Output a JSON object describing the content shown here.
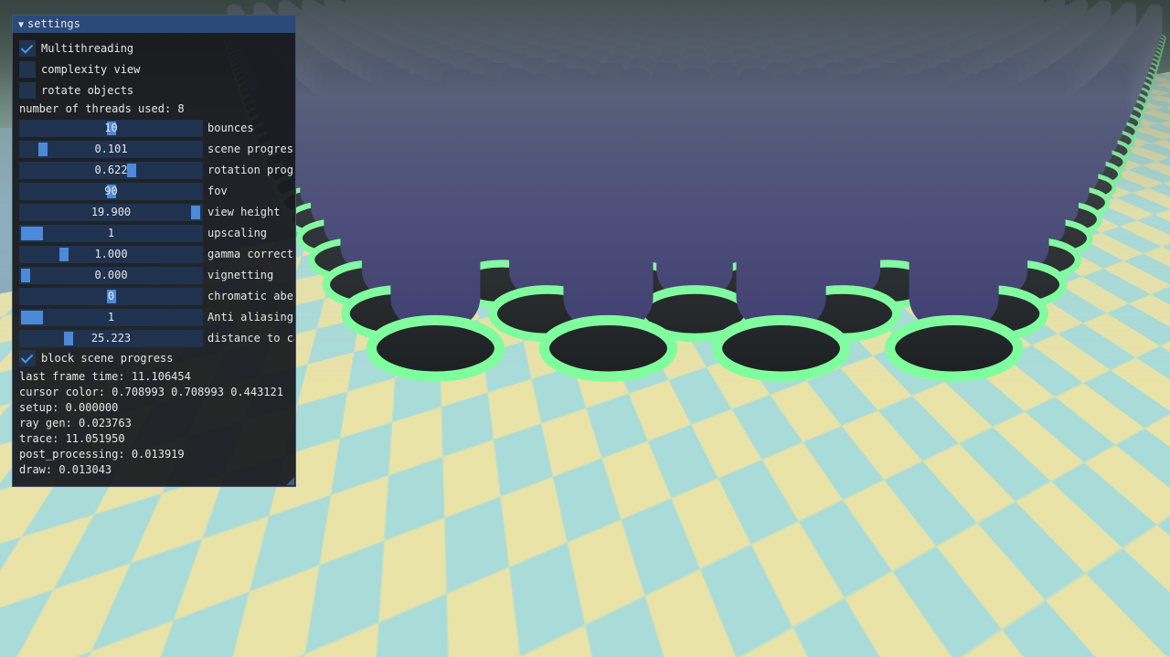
{
  "window": {
    "title": "settings",
    "collapse_icon": "triangle-down-icon"
  },
  "checkboxes": [
    {
      "label": "Multithreading",
      "checked": true
    },
    {
      "label": "complexity view",
      "checked": false
    },
    {
      "label": "rotate objects",
      "checked": false
    }
  ],
  "threads_text": "number of threads used: 8",
  "sliders": [
    {
      "label": "bounces",
      "value": "10",
      "fraction": 0.5
    },
    {
      "label": "scene progress",
      "value": "0.101",
      "fraction": 0.101
    },
    {
      "label": "rotation progress",
      "value": "0.622",
      "fraction": 0.622
    },
    {
      "label": "fov",
      "value": "90",
      "fraction": 0.5
    },
    {
      "label": "view height",
      "value": "19.900",
      "fraction": 0.995
    },
    {
      "label": "upscaling",
      "value": "1",
      "fraction": 0.0
    },
    {
      "label": "gamma correction",
      "value": "1.000",
      "fraction": 0.222
    },
    {
      "label": "vignetting",
      "value": "0.000",
      "fraction": 0.0
    },
    {
      "label": "chromatic aberration",
      "value": "0",
      "fraction": 0.5
    },
    {
      "label": "Anti aliasing",
      "value": "1",
      "fraction": 0.0
    },
    {
      "label": "distance to camera",
      "value": "25.223",
      "fraction": 0.252
    }
  ],
  "block_checkbox": {
    "label": "block scene progress",
    "checked": true
  },
  "stats": [
    "last frame time: 11.106454",
    "cursor color: 0.708993 0.708993 0.443121",
    "setup: 0.000000",
    "ray gen: 0.023763",
    "trace: 11.051950",
    "post_processing: 0.013919",
    "draw: 0.013043"
  ],
  "colors": {
    "accent": "#4c89d8",
    "title_bar": "#294a7a",
    "floor_yellow": "#e9e3a8",
    "floor_cyan": "#a9dcd9",
    "statue_glow": "#7dff9c"
  }
}
